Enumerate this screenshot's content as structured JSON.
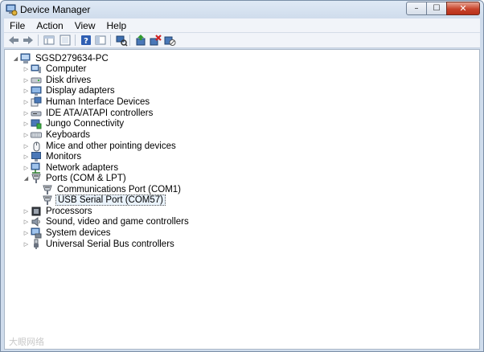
{
  "window": {
    "title": "Device Manager",
    "caption": {
      "minimize": "–",
      "maximize": "☐",
      "close": "✕"
    }
  },
  "menu": [
    "File",
    "Action",
    "View",
    "Help"
  ],
  "toolbar_icons": [
    "back-icon",
    "forward-icon",
    "properties-grid-icon",
    "view-icon",
    "help-icon",
    "console-icon",
    "scan-hardware-icon",
    "update-driver-icon",
    "uninstall-icon",
    "disable-icon"
  ],
  "tree": {
    "root": "SGSD279634-PC",
    "categories": [
      {
        "label": "Computer",
        "icon": "computer-icon"
      },
      {
        "label": "Disk drives",
        "icon": "disk-drive-icon"
      },
      {
        "label": "Display adapters",
        "icon": "display-adapter-icon"
      },
      {
        "label": "Human Interface Devices",
        "icon": "hid-icon"
      },
      {
        "label": "IDE ATA/ATAPI controllers",
        "icon": "ide-controller-icon"
      },
      {
        "label": "Jungo Connectivity",
        "icon": "jungo-icon"
      },
      {
        "label": "Keyboards",
        "icon": "keyboard-icon"
      },
      {
        "label": "Mice and other pointing devices",
        "icon": "mouse-icon"
      },
      {
        "label": "Monitors",
        "icon": "monitor-icon"
      },
      {
        "label": "Network adapters",
        "icon": "network-adapter-icon"
      },
      {
        "label": "Ports (COM & LPT)",
        "icon": "port-icon",
        "expanded": true,
        "children": [
          {
            "label": "Communications Port (COM1)",
            "icon": "port-icon"
          },
          {
            "label": "USB Serial Port (COM57)",
            "icon": "port-icon",
            "selected": true
          }
        ]
      },
      {
        "label": "Processors",
        "icon": "processor-icon"
      },
      {
        "label": "Sound, video and game controllers",
        "icon": "sound-icon"
      },
      {
        "label": "System devices",
        "icon": "system-devices-icon"
      },
      {
        "label": "Universal Serial Bus controllers",
        "icon": "usb-icon"
      }
    ]
  },
  "watermark": "大眼网络"
}
